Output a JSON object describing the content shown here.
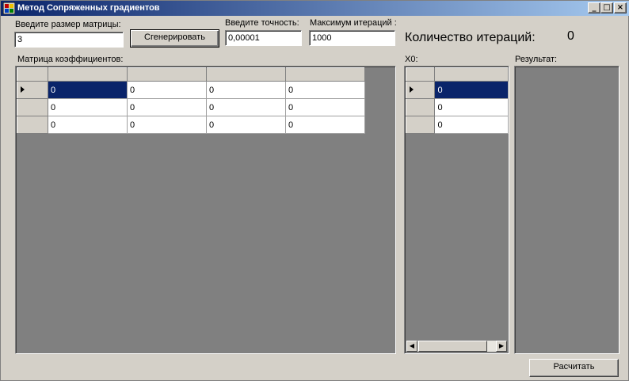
{
  "window": {
    "title": "Метод Сопряженных градиентов",
    "controls": {
      "minimize": "_",
      "maximize": "□",
      "close": "×"
    }
  },
  "matrix_size": {
    "label": "Введите размер матрицы:",
    "value": "3"
  },
  "generate_button": "Сгенерировать",
  "precision": {
    "label": "Введите точность:",
    "value": "0,00001"
  },
  "max_iterations": {
    "label": "Максимум итераций :",
    "value": "1000"
  },
  "iterations_count": {
    "label": "Количество итераций:",
    "value": "0"
  },
  "matrix": {
    "label": "Матрица коэффициентов:",
    "rows": [
      [
        "0",
        "0",
        "0",
        "0"
      ],
      [
        "0",
        "0",
        "0",
        "0"
      ],
      [
        "0",
        "0",
        "0",
        "0"
      ]
    ],
    "selected_row": 0
  },
  "x0": {
    "label": "X0:",
    "rows": [
      "0",
      "0",
      "0"
    ],
    "selected_row": 0
  },
  "result": {
    "label": "Результат:"
  },
  "calculate_button": "Расчитать",
  "colors": {
    "selection": "#0a246a",
    "grid_background": "#808080",
    "window_background": "#d4d0c8"
  }
}
